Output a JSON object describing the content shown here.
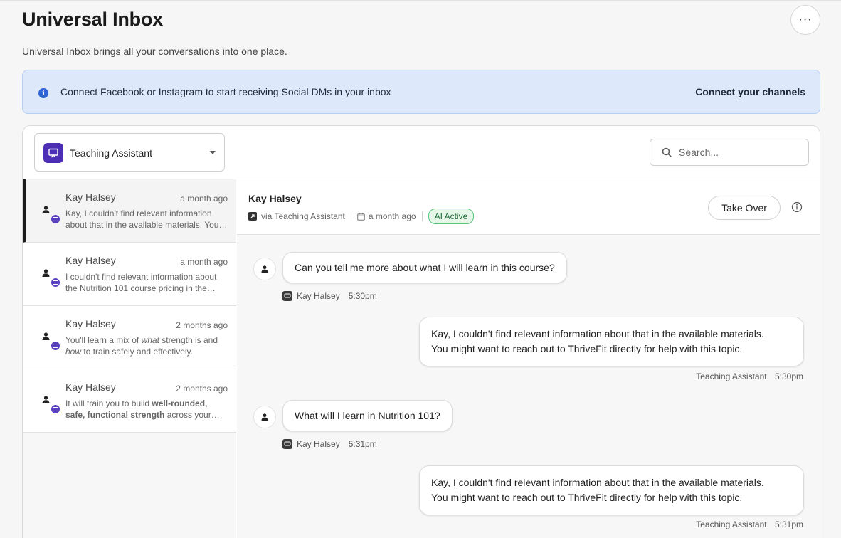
{
  "page": {
    "title": "Universal Inbox",
    "subtitle": "Universal Inbox brings all your conversations into one place.",
    "more_label": "···"
  },
  "banner": {
    "text": "Connect Facebook or Instagram to start receiving Social DMs in your inbox",
    "link": "Connect your channels",
    "accent": "#2e63d6"
  },
  "agent_select": {
    "value": "Teaching Assistant"
  },
  "search": {
    "placeholder": "Search..."
  },
  "conversations": [
    {
      "name": "Kay Halsey",
      "time": "a month ago",
      "preview": "Kay, I couldn't find relevant information about that in the available materials. You might want to reach out to ThriveFit directly for help with this topic."
    },
    {
      "name": "Kay Halsey",
      "time": "a month ago",
      "preview": "I couldn't find relevant information about the Nutrition 101 course pricing in the available materials."
    },
    {
      "name": "Kay Halsey",
      "time": "2 months ago",
      "preview_parts": [
        "You'll learn a mix of ",
        "what",
        " strength is and ",
        "how",
        " to train safely and effectively."
      ]
    },
    {
      "name": "Kay Halsey",
      "time": "2 months ago",
      "preview_parts": [
        "It will train you to build ",
        "well-rounded, safe, functional strength",
        " across your whole body."
      ]
    }
  ],
  "thread": {
    "name": "Kay Halsey",
    "via": "via Teaching Assistant",
    "time": "a month ago",
    "status": "AI Active",
    "takeover_label": "Take Over",
    "messages": [
      {
        "dir": "in",
        "text": "Can you tell me more about what I will learn in this course?",
        "sender": "Kay Halsey",
        "time": "5:30pm"
      },
      {
        "dir": "out",
        "line1": "Kay, I couldn't find relevant information about that in the available materials.",
        "line2": "You might want to reach out to ThriveFit directly for help with this topic.",
        "sender": "Teaching Assistant",
        "time": "5:30pm"
      },
      {
        "dir": "in",
        "text": "What will I learn in Nutrition 101?",
        "sender": "Kay Halsey",
        "time": "5:31pm"
      },
      {
        "dir": "out",
        "line1": "Kay, I couldn't find relevant information about that in the available materials.",
        "line2": "You might want to reach out to ThriveFit directly for help with this topic.",
        "sender": "Teaching Assistant",
        "time": "5:31pm"
      }
    ]
  }
}
